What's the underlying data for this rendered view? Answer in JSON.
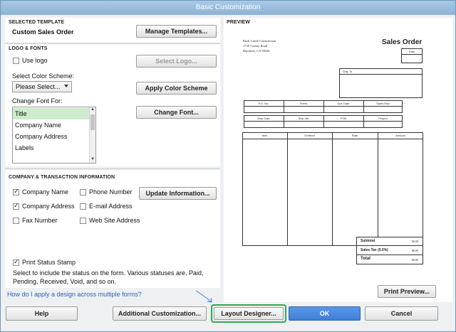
{
  "window": {
    "title": "Basic Customization"
  },
  "selected_template": {
    "section_title": "SELECTED TEMPLATE",
    "name": "Custom Sales Order",
    "manage_button": "Manage Templates..."
  },
  "logo_fonts": {
    "section_title": "LOGO & FONTS",
    "use_logo_label": "Use logo",
    "select_logo_button": "Select Logo...",
    "color_scheme_label": "Select Color Scheme:",
    "color_scheme_value": "Please Select...",
    "apply_color_button": "Apply Color Scheme",
    "change_font_label": "Change Font For:",
    "font_items": [
      "Title",
      "Company Name",
      "Company Address",
      "Labels"
    ],
    "change_font_button": "Change Font..."
  },
  "company_info": {
    "section_title": "COMPANY & TRANSACTION INFORMATION",
    "company_name_label": "Company Name",
    "phone_number_label": "Phone Number",
    "company_address_label": "Company Address",
    "email_address_label": "E-mail Address",
    "fax_number_label": "Fax Number",
    "website_address_label": "Web Site Address",
    "update_button": "Update Information...",
    "print_status_label": "Print Status Stamp",
    "status_hint": "Select to include the status on the form. Various statuses are, Paid, Pending, Received, Void, and so on."
  },
  "help_link": "How do I apply a design across multiple forms?",
  "preview": {
    "section_title": "PREVIEW",
    "company_name": "Rock Castle Construction",
    "address_line1": "1735 County Road",
    "address_line2": "Bayshore, CA 94326",
    "doc_title": "Sales Order",
    "date_label": "Date",
    "ship_to_label": "Ship To",
    "row1_headers": [
      "P.O. No.",
      "Terms",
      "Due Date",
      "Sales Rep"
    ],
    "row2_headers": [
      "Ship Date",
      "Ship Via",
      "FOB",
      "Project"
    ],
    "item_headers": [
      "Item",
      "Ordered",
      "Rate",
      "Amount"
    ],
    "subtotal_label": "Subtotal",
    "salestax_label": "Sales Tax (0.0%)",
    "total_label": "Total",
    "subtotal_value": "$0.00",
    "salestax_value": "$0.00",
    "total_value": "$0.00",
    "print_preview_button": "Print Preview..."
  },
  "footer": {
    "help_button": "Help",
    "additional_button": "Additional Customization...",
    "layout_button": "Layout Designer...",
    "ok_button": "OK",
    "cancel_button": "Cancel"
  },
  "colors": {
    "ok_blue": "#3f7fd6",
    "highlight_green": "#2fa84f",
    "selected_font_bg": "#cdeccd"
  }
}
